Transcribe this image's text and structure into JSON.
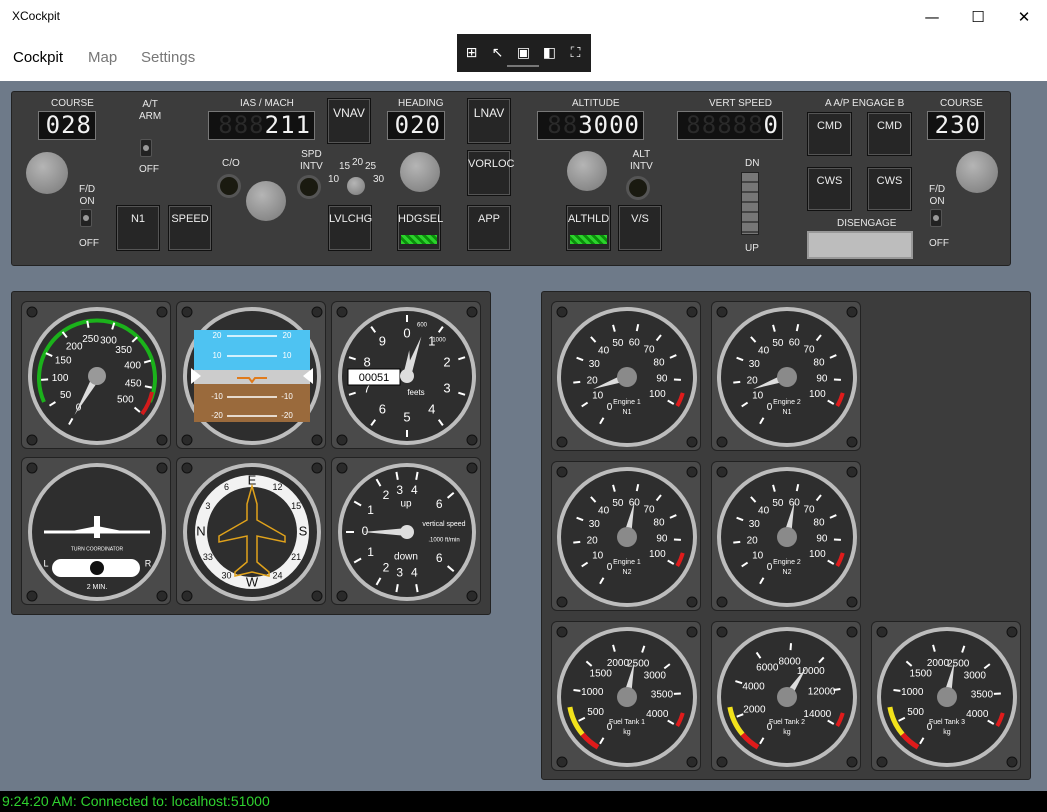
{
  "window": {
    "title": "XCockpit",
    "minimize_glyph": "—",
    "maximize_glyph": "☐",
    "close_glyph": "✕"
  },
  "menu": {
    "tabs": [
      "Cockpit",
      "Map",
      "Settings"
    ],
    "active": "Cockpit"
  },
  "toolbar": {
    "icons": [
      "add-panel-icon",
      "select-icon",
      "fit-icon",
      "instrument-icon",
      "fullscreen-icon"
    ]
  },
  "mcp": {
    "course_left": {
      "label": "COURSE",
      "value": "028"
    },
    "at_arm": {
      "label_top": "A/T",
      "label_mid": "ARM",
      "label_off": "OFF"
    },
    "ias_mach": {
      "label": "IAS / MACH",
      "value": "211"
    },
    "vnav": "VNAV",
    "co": "C/O",
    "spd_intv": {
      "l1": "SPD",
      "l2": "INTV"
    },
    "speed_scale": [
      "10",
      "15",
      "20",
      "25",
      "30"
    ],
    "heading": {
      "label": "HEADING",
      "value": "020"
    },
    "lnav": "LNAV",
    "vorloc": "VORLOC",
    "altitude": {
      "label": "ALTITUDE",
      "value": "3000"
    },
    "alt_intv": {
      "l1": "ALT",
      "l2": "INTV"
    },
    "vert_speed": {
      "label": "VERT SPEED",
      "value": "0"
    },
    "dn": "DN",
    "up": "UP",
    "ap_engage": "A A/P ENGAGE B",
    "cmd_a": "CMD",
    "cmd_b": "CMD",
    "cws_a": "CWS",
    "cws_b": "CWS",
    "disengage": "DISENGAGE",
    "course_right": {
      "label": "COURSE",
      "value": "230"
    },
    "fd_left": {
      "l1": "F/D",
      "l2": "ON",
      "l3": "OFF"
    },
    "fd_right": {
      "l1": "F/D",
      "l2": "ON",
      "l3": "OFF"
    },
    "n1": "N1",
    "speed": "SPEED",
    "lvlchg": "LVLCHG",
    "hdgsel": "HDGSEL",
    "app": "APP",
    "althld": "ALTHLD",
    "vs": "V/S"
  },
  "instruments": {
    "airspeed": {
      "ticks": [
        "0",
        "50",
        "100",
        "150",
        "200",
        "250",
        "300",
        "350",
        "400",
        "450",
        "500"
      ],
      "value": 0
    },
    "attitude": {
      "pitch_labels": [
        "20",
        "10",
        "-10",
        "-20"
      ]
    },
    "altimeter": {
      "numbers": [
        "0",
        "1",
        "2",
        "3",
        "4",
        "5",
        "6",
        "7",
        "8",
        "9"
      ],
      "counter": "00051",
      "unit": "feets",
      "sub_top": "600",
      "sub_right": "1000"
    },
    "turn": {
      "title": "TURN COORDINATOR",
      "left": "L",
      "right": "R",
      "sub": "2 MIN."
    },
    "heading": {
      "cardinals": [
        "E",
        "S",
        "W",
        "N"
      ],
      "numbers": [
        "12",
        "15",
        "21",
        "24",
        "30",
        "33",
        "3",
        "6"
      ]
    },
    "vsi": {
      "up": "up",
      "down": "down",
      "label1": "vertical speed",
      "label2": ".1000 ft/min",
      "numbers": [
        "0",
        "1",
        "2",
        "3",
        "4",
        "6"
      ]
    }
  },
  "engines": [
    {
      "title": "Engine 1",
      "sub": "N1",
      "ticks": [
        "0",
        "10",
        "20",
        "30",
        "40",
        "50",
        "60",
        "70",
        "80",
        "90",
        "100"
      ],
      "value": 15
    },
    {
      "title": "Engine 2",
      "sub": "N1",
      "ticks": [
        "0",
        "10",
        "20",
        "30",
        "40",
        "50",
        "60",
        "70",
        "80",
        "90",
        "100"
      ],
      "value": 15
    },
    {
      "title": "Engine 1",
      "sub": "N2",
      "ticks": [
        "0",
        "10",
        "20",
        "30",
        "40",
        "50",
        "60",
        "70",
        "80",
        "90",
        "100"
      ],
      "value": 60
    },
    {
      "title": "Engine 2",
      "sub": "N2",
      "ticks": [
        "0",
        "10",
        "20",
        "30",
        "40",
        "50",
        "60",
        "70",
        "80",
        "90",
        "100"
      ],
      "value": 60
    }
  ],
  "tanks": [
    {
      "title": "Fuel Tank 1",
      "unit": "kg",
      "ticks": [
        "0",
        "500",
        "1000",
        "1500",
        "2000",
        "2500",
        "3000",
        "3500",
        "4000"
      ],
      "max": 4000,
      "value": 2400
    },
    {
      "title": "Fuel Tank 2",
      "unit": "kg",
      "ticks": [
        "0",
        "2000",
        "4000",
        "6000",
        "8000",
        "10000",
        "12000",
        "14000"
      ],
      "max": 14000,
      "value": 9500
    },
    {
      "title": "Fuel Tank 3",
      "unit": "kg",
      "ticks": [
        "0",
        "500",
        "1000",
        "1500",
        "2000",
        "2500",
        "3000",
        "3500",
        "4000"
      ],
      "max": 4000,
      "value": 2400
    }
  ],
  "status": {
    "text": "9:24:20 AM: Connected to: localhost:51000"
  }
}
